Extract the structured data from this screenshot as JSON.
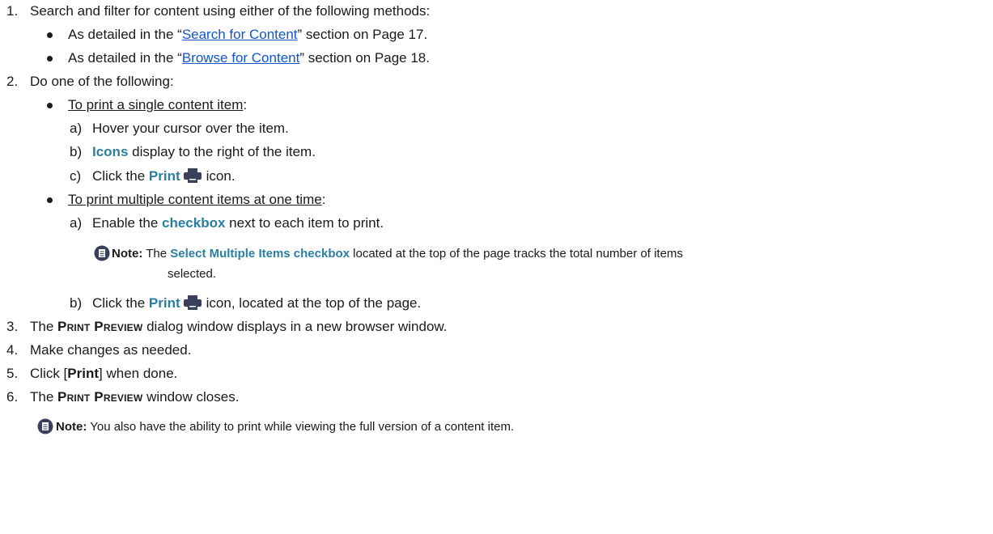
{
  "step1": {
    "number": "1.",
    "text": "Search and filter for content using either of the following methods:",
    "bullet1": {
      "pre": "As detailed in the “",
      "link": "Search for Content",
      "post": "” section on Page 17."
    },
    "bullet2": {
      "pre": "As detailed in the “",
      "link": "Browse for Content",
      "post": "” section on Page 18."
    }
  },
  "step2": {
    "number": "2.",
    "text": "Do one of the following:",
    "single": {
      "label": "To print a single content item",
      "colon": ":",
      "a": {
        "marker": "a)",
        "text": "Hover your cursor over the item."
      },
      "b": {
        "marker": "b)",
        "kw": "Icons",
        "text": " display to the right of the item."
      },
      "c": {
        "marker": "c)",
        "pre": "Click the ",
        "kw": "Print",
        "post": "icon."
      }
    },
    "multiple": {
      "label": "To print multiple content items at one time",
      "colon": ":",
      "a": {
        "marker": "a)",
        "pre": "Enable the ",
        "kw": "checkbox",
        "post": " next to each item to print."
      },
      "note": {
        "label": "Note:",
        "pre": " The ",
        "kw": "Select Multiple Items checkbox",
        "post": " located at the top of the page tracks the total number of items",
        "cont": "selected."
      },
      "b": {
        "marker": "b)",
        "pre": "Click the ",
        "kw": "Print",
        "post": "icon, located at the top of the page."
      }
    }
  },
  "step3": {
    "number": "3.",
    "pre": "The ",
    "sc": "Print Preview",
    "post": " dialog window displays in a new browser window."
  },
  "step4": {
    "number": "4.",
    "text": "Make changes as needed."
  },
  "step5": {
    "number": "5.",
    "pre": "Click [",
    "b": "Print",
    "post": "] when done."
  },
  "step6": {
    "number": "6.",
    "pre": "The ",
    "sc": "Print Preview",
    "post": " window closes."
  },
  "final_note": {
    "label": "Note:",
    "text": " You also have the ability to print while viewing the full version of a content item."
  },
  "colors": {
    "link": "#1155cc",
    "keyword": "#2a7fa0",
    "icon": "#3a3f5c"
  }
}
